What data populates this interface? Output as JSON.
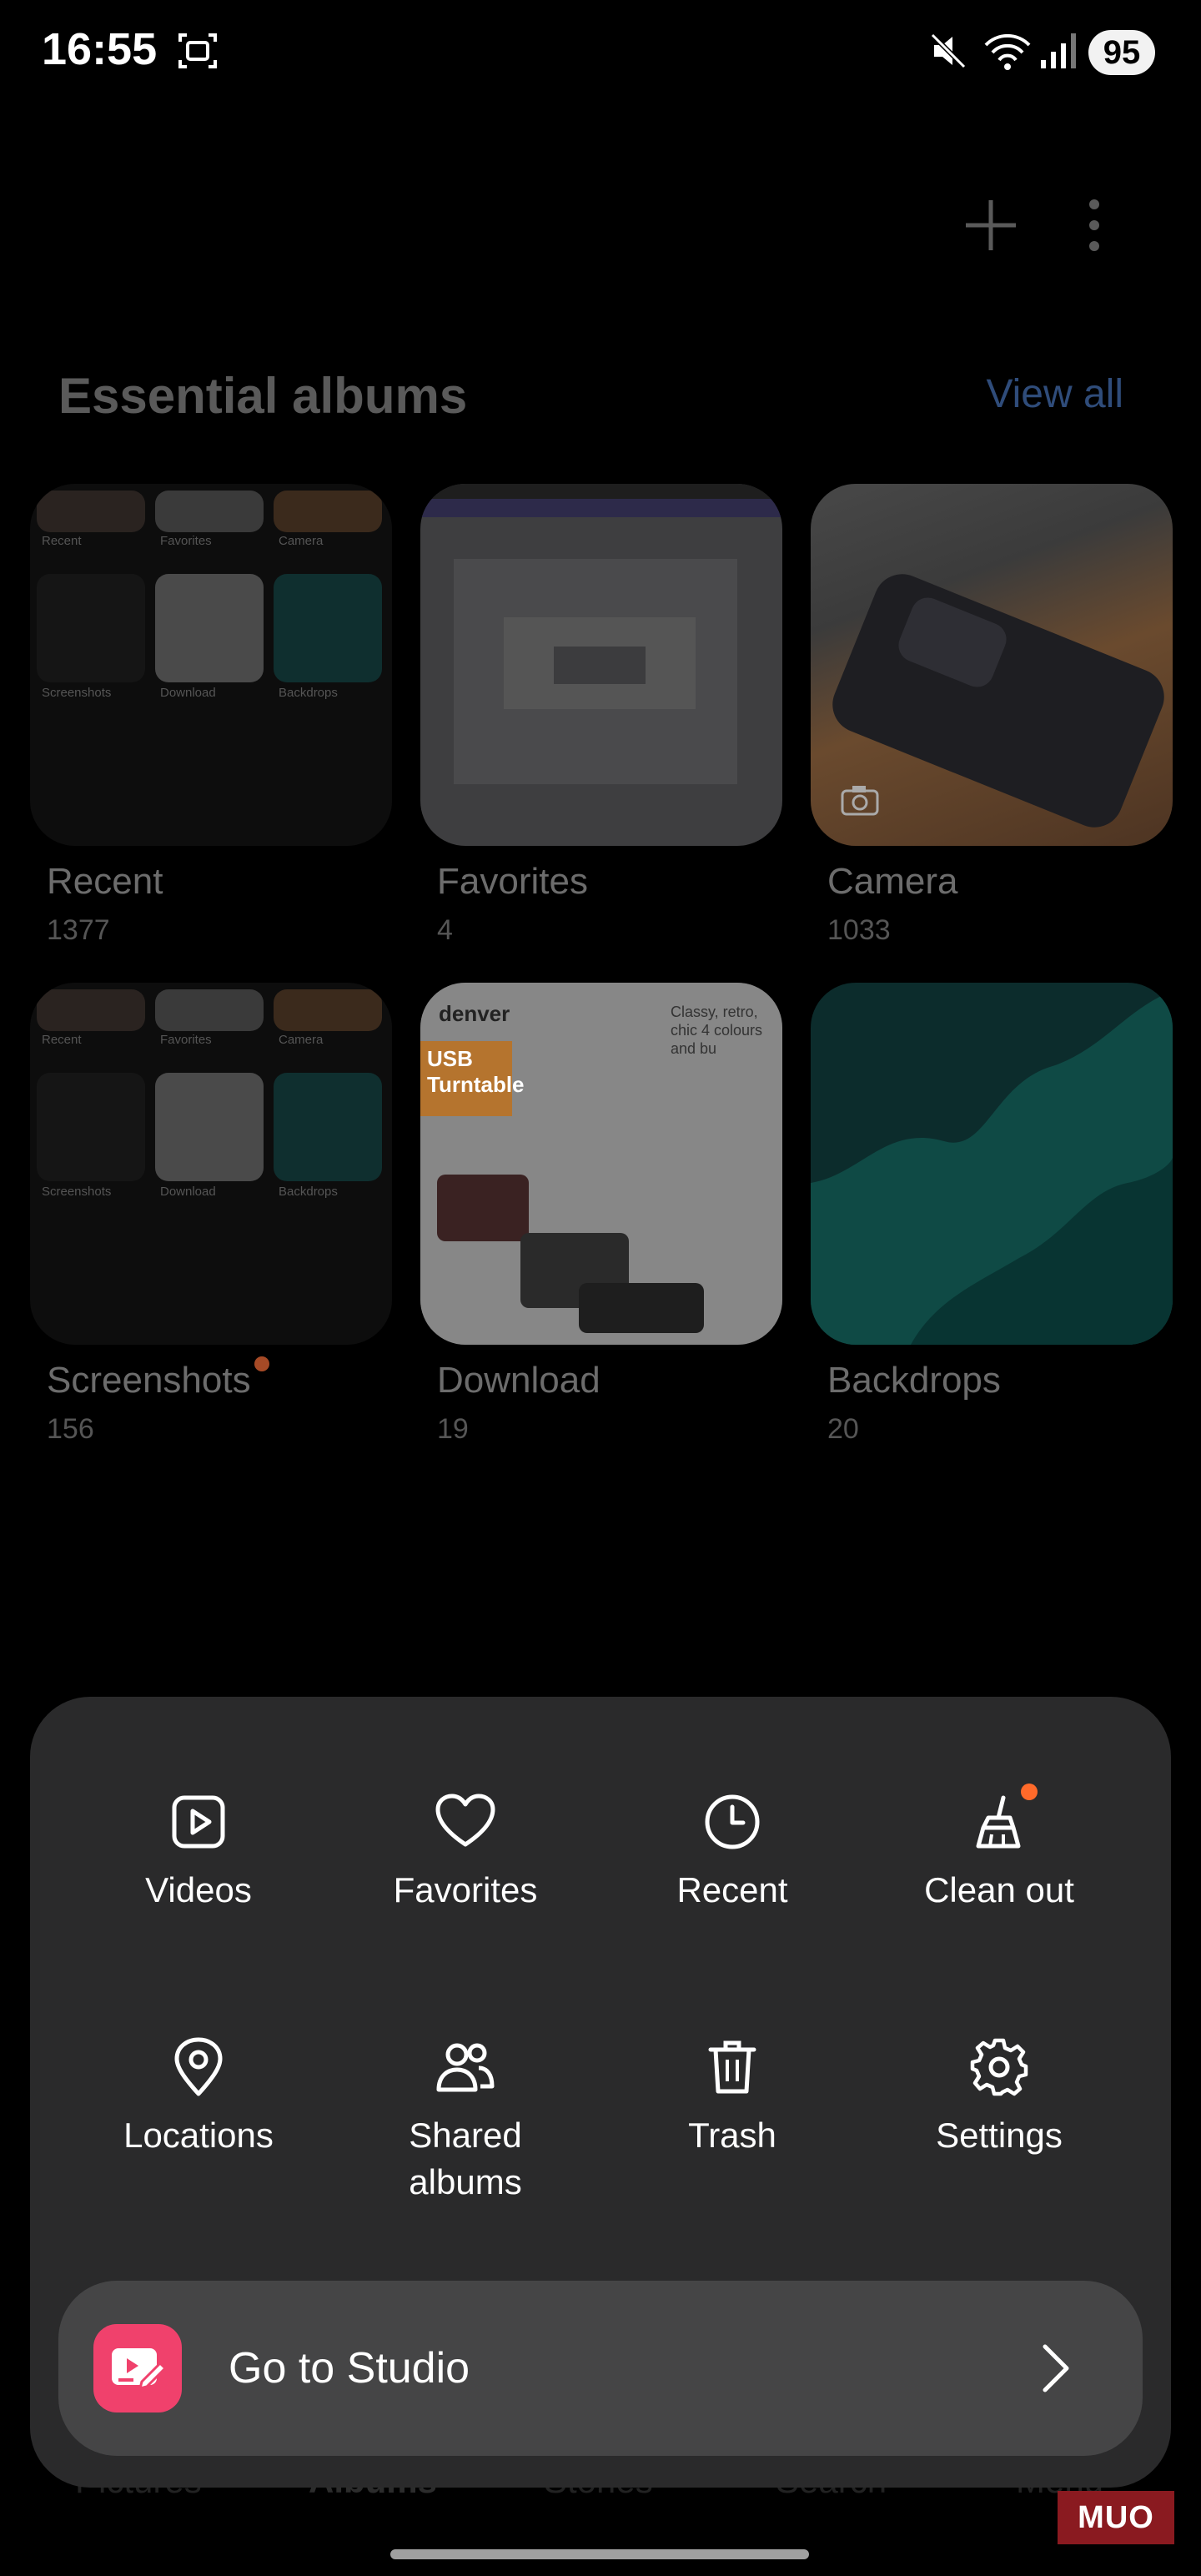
{
  "status_bar": {
    "time": "16:55",
    "battery": "95"
  },
  "header": {
    "section_title": "Essential albums",
    "view_all": "View all"
  },
  "albums": [
    {
      "name": "Recent",
      "count": "1377"
    },
    {
      "name": "Favorites",
      "count": "4"
    },
    {
      "name": "Camera",
      "count": "1033"
    },
    {
      "name": "Screenshots",
      "count": "156"
    },
    {
      "name": "Download",
      "count": "19"
    },
    {
      "name": "Backdrops",
      "count": "20"
    }
  ],
  "recent_thumb_labels": {
    "recent": "Recent",
    "favorites": "Favorites",
    "camera": "Camera",
    "screenshots": "Screenshots",
    "download": "Download",
    "backdrops": "Backdrops"
  },
  "download_thumb": {
    "brand": "denver",
    "headline": "USB Turntable",
    "tagline": "Classy, retro, chic 4 colours and bu"
  },
  "menu": {
    "videos": "Videos",
    "favorites": "Favorites",
    "recent": "Recent",
    "clean_out": "Clean out",
    "locations": "Locations",
    "shared_albums_line1": "Shared",
    "shared_albums_line2": "albums",
    "trash": "Trash",
    "settings": "Settings"
  },
  "studio": {
    "label": "Go to Studio"
  },
  "bottom_nav": {
    "pictures": "Pictures",
    "albums": "Albums",
    "stories": "Stories",
    "search": "Search",
    "menu": "Menu"
  },
  "watermark": "MUO",
  "colors": {
    "accent_dot": "#ff6a2a",
    "studio_icon": "#f0416c",
    "sheet": "#2a2a2b"
  }
}
